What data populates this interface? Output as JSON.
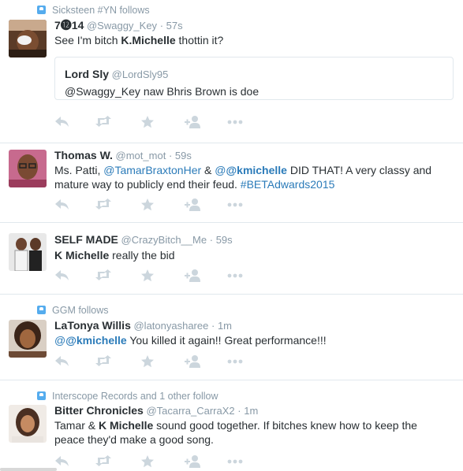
{
  "colors": {
    "link": "#2b7bb9",
    "muted": "#8899a6",
    "action_icon": "#ccd6dd",
    "follow_icon": "#55acee",
    "divider": "#e1e8ed"
  },
  "icons": {
    "reply": "reply-icon",
    "retweet": "retweet-icon",
    "favorite": "star-icon",
    "follow": "follow-icon",
    "more": "more-icon",
    "context": "follow-context-icon"
  },
  "tweets": [
    {
      "context": "Sicksteen #YN follows",
      "name": "7⓬14",
      "handle": "@Swaggy_Key",
      "dot": "·",
      "time": "57s",
      "text_parts": [
        "See I'm bitch ",
        "K.Michelle",
        " thottin it?"
      ],
      "quote": {
        "name": "Lord Sly",
        "handle": "@LordSly95",
        "text": "@Swaggy_Key naw Bhris Brown is doe"
      }
    },
    {
      "name": "Thomas W.",
      "handle": "@mot_mot",
      "dot": "·",
      "time": "59s",
      "text_parts": [
        "Ms. Patti, ",
        "@TamarBraxtonHer",
        " & ",
        "@kmichelle",
        " DID THAT! A very classy and",
        "mature way to publicly end their feud. ",
        "#BETAdwards2015"
      ]
    },
    {
      "name": "SELF MADE",
      "handle": "@CrazyBitch__Me",
      "dot": "·",
      "time": "59s",
      "text_parts": [
        "K Michelle",
        " really the bid"
      ]
    },
    {
      "context": "GGM follows",
      "name": "LaTonya Willis",
      "handle": "@latonyasharee",
      "dot": "·",
      "time": "1m",
      "text_parts": [
        "@kmichelle",
        " You killed it again!! Great performance!!!"
      ]
    },
    {
      "context": "Interscope Records and 1 other follow",
      "name": "Bitter Chronicles",
      "handle": "@Tacarra_CarraX2",
      "dot": "·",
      "time": "1m",
      "text_parts": [
        "Tamar & ",
        "K Michelle",
        " sound good together. If bitches knew how to keep the",
        "peace they'd make a good song."
      ]
    }
  ]
}
